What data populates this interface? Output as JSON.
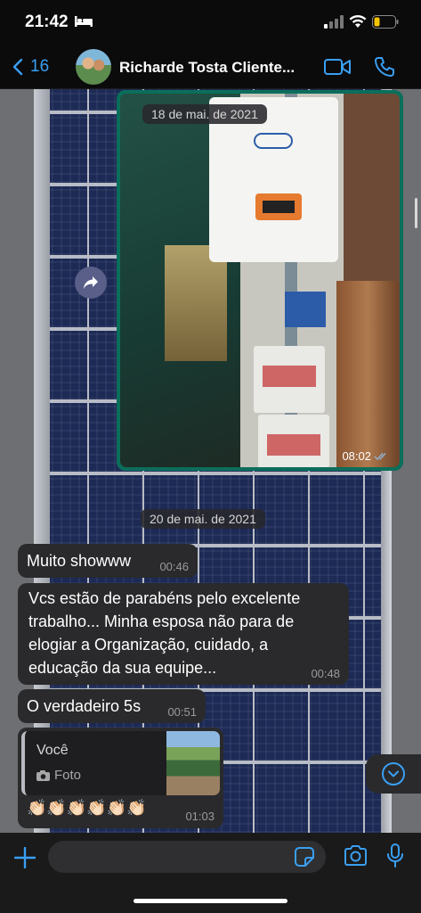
{
  "status_bar": {
    "time": "21:42",
    "icons": [
      "bed-icon",
      "signal-icon",
      "wifi-icon",
      "battery-icon"
    ],
    "battery_color": "#f5c400"
  },
  "header": {
    "back_count": "16",
    "contact_name": "Richarde Tosta Cliente...",
    "icons": [
      "video-call-icon",
      "phone-call-icon"
    ],
    "accent": "#3a9ff2"
  },
  "messages": {
    "date1": "18 de mai. de 2021",
    "photo_time": "08:02",
    "date2": "20 de mai. de 2021",
    "m1_text": "Muito showww",
    "m1_time": "00:46",
    "m2_text": "Vcs estão de parabéns pelo excelente trabalho... Minha esposa não para de elogiar a Organização, cuidado, a educação da sua equipe...",
    "m2_time": "00:48",
    "m3_text": "O verdadeiro 5s",
    "m3_time": "00:51",
    "reply_author": "Você",
    "reply_type": "Foto",
    "reply_text": "👏🏻👏🏻👏🏻👏🏻👏🏻👏🏻",
    "reply_time": "01:03"
  },
  "input_bar": {
    "placeholder": "",
    "icons": [
      "plus-icon",
      "sticker-icon",
      "camera-icon",
      "microphone-icon"
    ]
  }
}
